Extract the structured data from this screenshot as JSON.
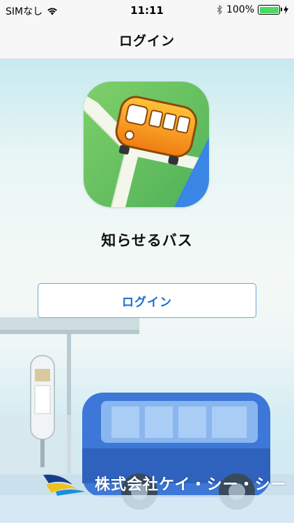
{
  "status_bar": {
    "carrier": "SIMなし",
    "time": "11:11",
    "battery_percent": "100%",
    "battery_level": 1.0
  },
  "nav": {
    "title": "ログイン"
  },
  "app": {
    "name": "知らせるバス"
  },
  "login_button": {
    "label": "ログイン"
  },
  "footer": {
    "company_name": "株式会社ケイ・シー・シー"
  },
  "colors": {
    "accent": "#1a6fd1",
    "battery": "#4cd964",
    "icon_bus": "#f29a1f",
    "icon_map": "#6cc067"
  }
}
